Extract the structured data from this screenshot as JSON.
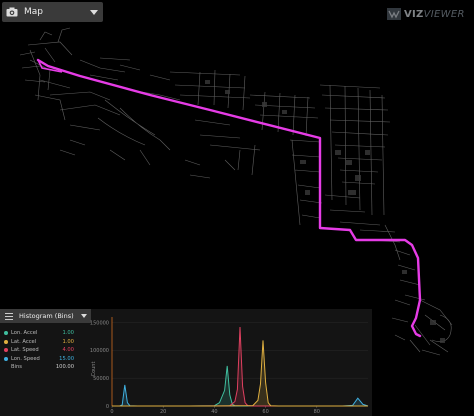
{
  "map_panel": {
    "title": "Map",
    "camera_icon": "camera-icon",
    "menu_icon": "chevron-down-icon"
  },
  "logo": {
    "prefix": "VIZ",
    "suffix": "VIEWER"
  },
  "route_color": "#e63ce6",
  "histogram_panel": {
    "title": "Histogram (Bins)",
    "menu_icon": "list-icon",
    "legend": [
      {
        "name": "Lon. Accel",
        "value": "1.00",
        "color": "#3fbf9f"
      },
      {
        "name": "Lat. Accel",
        "value": "1.00",
        "color": "#e0b040"
      },
      {
        "name": "Lat. Speed",
        "value": "4.00",
        "color": "#e04060"
      },
      {
        "name": "Lon. Speed",
        "value": "15.00",
        "color": "#3fb0e0"
      },
      {
        "name": "Bins",
        "value": "100.00",
        "color": ""
      }
    ]
  },
  "chart_data": {
    "type": "line",
    "ylabel": "Count",
    "ylim": [
      0,
      160000
    ],
    "xlim": [
      0,
      100
    ],
    "yticks": [
      "150000",
      "100000",
      "50000",
      "0"
    ],
    "ytick_values": [
      150000,
      100000,
      50000,
      0
    ],
    "xticks": [
      "0",
      "20",
      "40",
      "60",
      "80"
    ],
    "xtick_values": [
      0,
      20,
      40,
      60,
      80
    ],
    "series": [
      {
        "color": "#3fb0e0",
        "x": [
          0,
          3,
          4,
          5,
          6,
          7,
          10,
          30,
          50,
          70,
          90,
          94,
          96,
          98,
          100
        ],
        "y": [
          0,
          0,
          2000,
          38000,
          6000,
          500,
          0,
          0,
          0,
          0,
          0,
          1000,
          14000,
          3000,
          0
        ]
      },
      {
        "color": "#3fbf9f",
        "x": [
          0,
          30,
          40,
          42,
          44,
          45,
          46,
          47,
          48,
          50,
          60,
          100
        ],
        "y": [
          0,
          0,
          600,
          6000,
          28000,
          72000,
          20000,
          3000,
          500,
          0,
          0,
          0
        ]
      },
      {
        "color": "#e04060",
        "x": [
          0,
          30,
          46,
          48,
          49,
          50,
          51,
          52,
          53,
          55,
          60,
          100
        ],
        "y": [
          0,
          0,
          500,
          8000,
          30000,
          142000,
          35000,
          6000,
          800,
          0,
          0,
          0
        ]
      },
      {
        "color": "#e0b040",
        "x": [
          0,
          40,
          55,
          57,
          58,
          59,
          60,
          61,
          62,
          65,
          100
        ],
        "y": [
          0,
          0,
          800,
          10000,
          40000,
          118000,
          42000,
          6000,
          500,
          0,
          0
        ]
      }
    ]
  }
}
